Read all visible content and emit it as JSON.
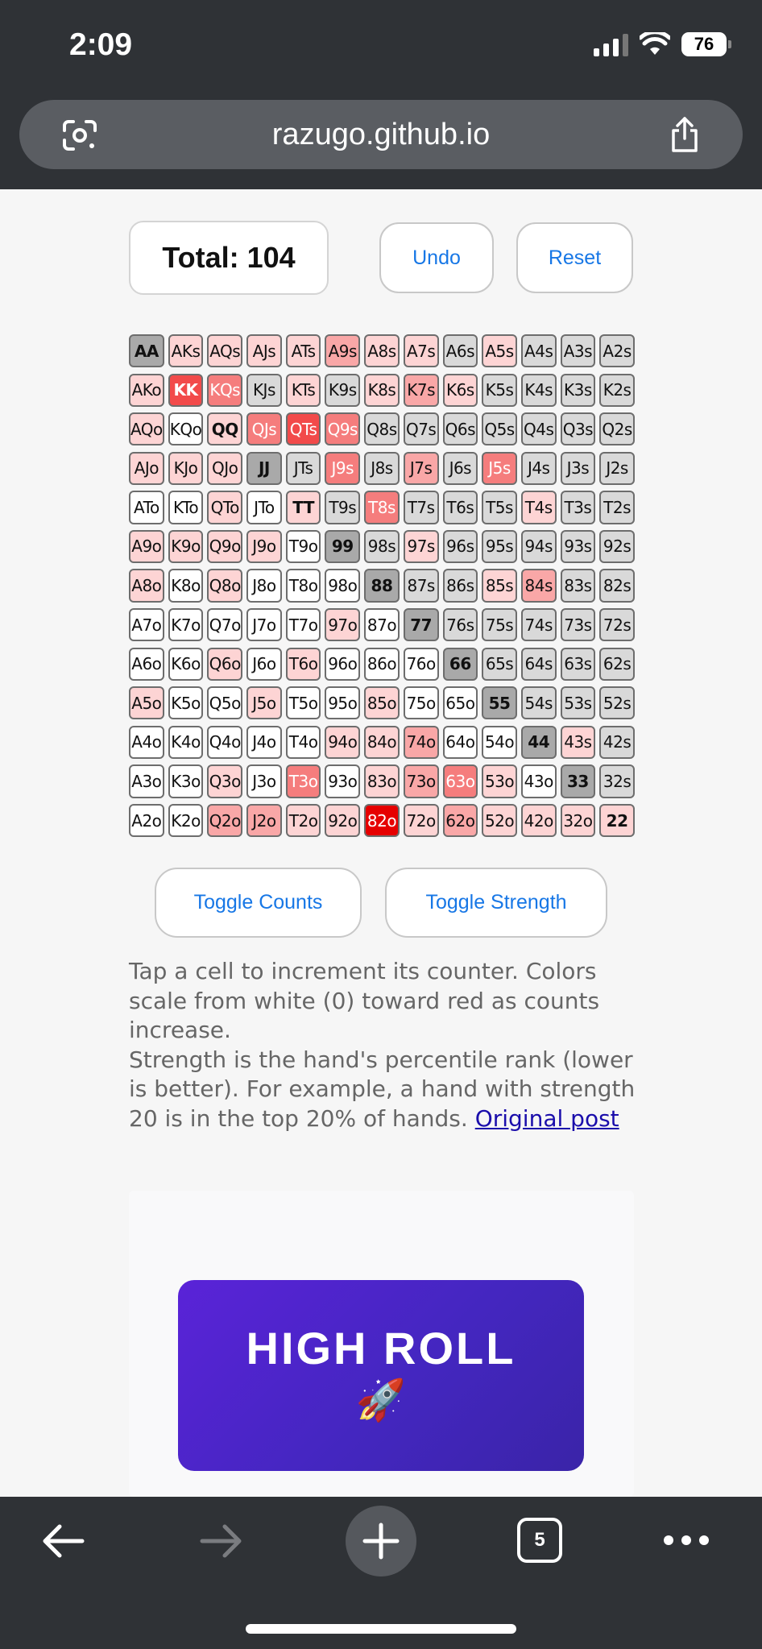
{
  "status": {
    "time": "2:09",
    "battery": "76",
    "signal_icon": "cellular-signal-icon",
    "wifi_icon": "wifi-icon"
  },
  "browser": {
    "url": "razugo.github.io",
    "left_icon": "page-scan-icon",
    "right_icon": "share-icon",
    "tab_count": "5"
  },
  "counter": {
    "total": "Total: 104",
    "undo_label": "Undo",
    "reset_label": "Reset"
  },
  "toggles": {
    "counts_label": "Toggle Counts",
    "strength_label": "Toggle Strength"
  },
  "help": {
    "line1": "Tap a cell to increment its counter. Colors scale from white (0) toward red as counts increase.",
    "line2": "Strength is the hand's percentile rank (lower is better). For example, a hand with strength 20 is in the top 20% of hands. ",
    "link": "Original post"
  },
  "ad": {
    "title": "HIGH ROLL",
    "emoji": "🚀"
  },
  "colors": {
    "pair_gray": "#a9a9a9",
    "suited_gray": "#d9d9d9",
    "offsuit_white": "#ffffff",
    "heat_1": "#fdd4d4",
    "heat_2": "#f9a7a7",
    "heat_3": "#f57d7d",
    "heat_4": "#f24a4a",
    "heat_5": "#ee1a1a",
    "heat_6": "#e60000",
    "accent_blue": "#1777e6"
  },
  "grid": [
    [
      [
        "AA",
        "0"
      ],
      [
        "AKs",
        "1"
      ],
      [
        "AQs",
        "1"
      ],
      [
        "AJs",
        "1"
      ],
      [
        "ATs",
        "1"
      ],
      [
        "A9s",
        "2"
      ],
      [
        "A8s",
        "1"
      ],
      [
        "A7s",
        "1"
      ],
      [
        "A6s",
        "0"
      ],
      [
        "A5s",
        "1"
      ],
      [
        "A4s",
        "0"
      ],
      [
        "A3s",
        "0"
      ],
      [
        "A2s",
        "0"
      ]
    ],
    [
      [
        "AKo",
        "1"
      ],
      [
        "KK",
        "4"
      ],
      [
        "KQs",
        "3"
      ],
      [
        "KJs",
        "0"
      ],
      [
        "KTs",
        "1"
      ],
      [
        "K9s",
        "0"
      ],
      [
        "K8s",
        "1"
      ],
      [
        "K7s",
        "2"
      ],
      [
        "K6s",
        "1"
      ],
      [
        "K5s",
        "0"
      ],
      [
        "K4s",
        "0"
      ],
      [
        "K3s",
        "0"
      ],
      [
        "K2s",
        "0"
      ]
    ],
    [
      [
        "AQo",
        "1"
      ],
      [
        "KQo",
        "0"
      ],
      [
        "QQ",
        "1"
      ],
      [
        "QJs",
        "3"
      ],
      [
        "QTs",
        "4"
      ],
      [
        "Q9s",
        "3"
      ],
      [
        "Q8s",
        "0"
      ],
      [
        "Q7s",
        "0"
      ],
      [
        "Q6s",
        "0"
      ],
      [
        "Q5s",
        "0"
      ],
      [
        "Q4s",
        "0"
      ],
      [
        "Q3s",
        "0"
      ],
      [
        "Q2s",
        "0"
      ]
    ],
    [
      [
        "AJo",
        "1"
      ],
      [
        "KJo",
        "1"
      ],
      [
        "QJo",
        "1"
      ],
      [
        "JJ",
        "0"
      ],
      [
        "JTs",
        "0"
      ],
      [
        "J9s",
        "3"
      ],
      [
        "J8s",
        "0"
      ],
      [
        "J7s",
        "2"
      ],
      [
        "J6s",
        "0"
      ],
      [
        "J5s",
        "3"
      ],
      [
        "J4s",
        "0"
      ],
      [
        "J3s",
        "0"
      ],
      [
        "J2s",
        "0"
      ]
    ],
    [
      [
        "ATo",
        "0"
      ],
      [
        "KTo",
        "0"
      ],
      [
        "QTo",
        "1"
      ],
      [
        "JTo",
        "0"
      ],
      [
        "TT",
        "1"
      ],
      [
        "T9s",
        "0"
      ],
      [
        "T8s",
        "3"
      ],
      [
        "T7s",
        "0"
      ],
      [
        "T6s",
        "0"
      ],
      [
        "T5s",
        "0"
      ],
      [
        "T4s",
        "1"
      ],
      [
        "T3s",
        "0"
      ],
      [
        "T2s",
        "0"
      ]
    ],
    [
      [
        "A9o",
        "1"
      ],
      [
        "K9o",
        "1"
      ],
      [
        "Q9o",
        "1"
      ],
      [
        "J9o",
        "1"
      ],
      [
        "T9o",
        "0"
      ],
      [
        "99",
        "0"
      ],
      [
        "98s",
        "0"
      ],
      [
        "97s",
        "1"
      ],
      [
        "96s",
        "0"
      ],
      [
        "95s",
        "0"
      ],
      [
        "94s",
        "0"
      ],
      [
        "93s",
        "0"
      ],
      [
        "92s",
        "0"
      ]
    ],
    [
      [
        "A8o",
        "1"
      ],
      [
        "K8o",
        "0"
      ],
      [
        "Q8o",
        "1"
      ],
      [
        "J8o",
        "0"
      ],
      [
        "T8o",
        "0"
      ],
      [
        "98o",
        "0"
      ],
      [
        "88",
        "0"
      ],
      [
        "87s",
        "0"
      ],
      [
        "86s",
        "0"
      ],
      [
        "85s",
        "1"
      ],
      [
        "84s",
        "2"
      ],
      [
        "83s",
        "0"
      ],
      [
        "82s",
        "0"
      ]
    ],
    [
      [
        "A7o",
        "0"
      ],
      [
        "K7o",
        "0"
      ],
      [
        "Q7o",
        "0"
      ],
      [
        "J7o",
        "0"
      ],
      [
        "T7o",
        "0"
      ],
      [
        "97o",
        "1"
      ],
      [
        "87o",
        "0"
      ],
      [
        "77",
        "0"
      ],
      [
        "76s",
        "0"
      ],
      [
        "75s",
        "0"
      ],
      [
        "74s",
        "0"
      ],
      [
        "73s",
        "0"
      ],
      [
        "72s",
        "0"
      ]
    ],
    [
      [
        "A6o",
        "0"
      ],
      [
        "K6o",
        "0"
      ],
      [
        "Q6o",
        "1"
      ],
      [
        "J6o",
        "0"
      ],
      [
        "T6o",
        "1"
      ],
      [
        "96o",
        "0"
      ],
      [
        "86o",
        "0"
      ],
      [
        "76o",
        "0"
      ],
      [
        "66",
        "0"
      ],
      [
        "65s",
        "0"
      ],
      [
        "64s",
        "0"
      ],
      [
        "63s",
        "0"
      ],
      [
        "62s",
        "0"
      ]
    ],
    [
      [
        "A5o",
        "1"
      ],
      [
        "K5o",
        "0"
      ],
      [
        "Q5o",
        "0"
      ],
      [
        "J5o",
        "1"
      ],
      [
        "T5o",
        "0"
      ],
      [
        "95o",
        "0"
      ],
      [
        "85o",
        "1"
      ],
      [
        "75o",
        "0"
      ],
      [
        "65o",
        "0"
      ],
      [
        "55",
        "0"
      ],
      [
        "54s",
        "0"
      ],
      [
        "53s",
        "0"
      ],
      [
        "52s",
        "0"
      ]
    ],
    [
      [
        "A4o",
        "0"
      ],
      [
        "K4o",
        "0"
      ],
      [
        "Q4o",
        "0"
      ],
      [
        "J4o",
        "0"
      ],
      [
        "T4o",
        "0"
      ],
      [
        "94o",
        "1"
      ],
      [
        "84o",
        "1"
      ],
      [
        "74o",
        "2"
      ],
      [
        "64o",
        "0"
      ],
      [
        "54o",
        "0"
      ],
      [
        "44",
        "0"
      ],
      [
        "43s",
        "1"
      ],
      [
        "42s",
        "0"
      ]
    ],
    [
      [
        "A3o",
        "0"
      ],
      [
        "K3o",
        "0"
      ],
      [
        "Q3o",
        "1"
      ],
      [
        "J3o",
        "0"
      ],
      [
        "T3o",
        "3"
      ],
      [
        "93o",
        "0"
      ],
      [
        "83o",
        "1"
      ],
      [
        "73o",
        "2"
      ],
      [
        "63o",
        "3"
      ],
      [
        "53o",
        "1"
      ],
      [
        "43o",
        "0"
      ],
      [
        "33",
        "0"
      ],
      [
        "32s",
        "0"
      ]
    ],
    [
      [
        "A2o",
        "0"
      ],
      [
        "K2o",
        "0"
      ],
      [
        "Q2o",
        "2"
      ],
      [
        "J2o",
        "2"
      ],
      [
        "T2o",
        "1"
      ],
      [
        "92o",
        "1"
      ],
      [
        "82o",
        "6"
      ],
      [
        "72o",
        "1"
      ],
      [
        "62o",
        "2"
      ],
      [
        "52o",
        "1"
      ],
      [
        "42o",
        "1"
      ],
      [
        "32o",
        "1"
      ],
      [
        "22",
        "1"
      ]
    ]
  ]
}
